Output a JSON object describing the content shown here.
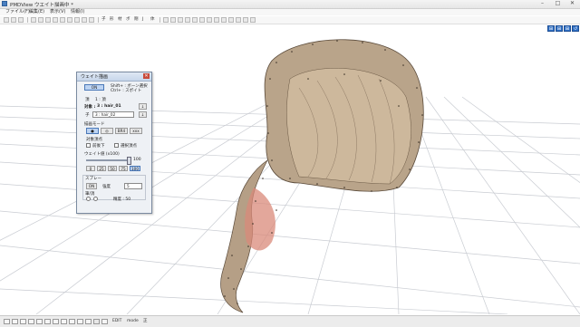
{
  "window": {
    "title": "PMDView ウエイト描画中 *"
  },
  "menu": {
    "items": [
      "ファイル(F)",
      "編集(E)",
      "表示(V)",
      "情報(I)"
    ]
  },
  "toolbar": {
    "items": [
      "子",
      "形",
      "材",
      "ボ",
      "剛",
      "J",
      "体"
    ]
  },
  "panel": {
    "title": "ウェイト描画",
    "on_button": "ON",
    "shortcut_line1": "Shift+ : ボーン選択",
    "shortcut_line2": "Ctrl+ : スポイト",
    "vertex_label": "頂",
    "vertex_value": "1 : 頂",
    "target_label": "対象 :",
    "target_value": "3 : hair_01",
    "bone_prefix": "子",
    "bone_select": "3 : hair_02",
    "mode_label": "描画モード",
    "mode_buttons": [
      "●",
      "◎",
      "BR4",
      "xxx"
    ],
    "target_verts_label": "対象頂点",
    "chk_front": "前後下",
    "chk_select": "選択頂点",
    "weight_label": "ウェイト値 (x100)",
    "weight_value": "100",
    "preset_buttons": [
      "0",
      "25",
      "50",
      "75",
      "100"
    ],
    "spray_label": "スプレー",
    "spray_btn": "ON",
    "density_label": "強度",
    "density_value": "5",
    "brush_label": "筆/消",
    "strength_label": "精度 : 50",
    "strength_value": "50"
  },
  "status": {
    "mode_text": "mode",
    "edit_text": "EDIT",
    "extra_text": "正"
  }
}
